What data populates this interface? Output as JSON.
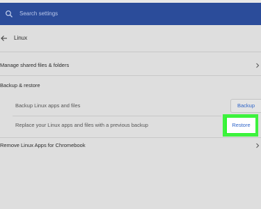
{
  "search": {
    "placeholder": "Search settings"
  },
  "page": {
    "title": "Linux"
  },
  "items": {
    "manage_shared": "Manage shared files & folders",
    "backup_restore_heading": "Backup & restore",
    "backup_description": "Backup Linux apps and files",
    "backup_button": "Backup",
    "restore_description": "Replace your Linux apps and files with a previous backup",
    "restore_button": "Restore",
    "remove_linux": "Remove Linux Apps for Chromebook"
  },
  "colors": {
    "header": "#2b4c9a",
    "background": "#dedede",
    "accent_link": "#2f64c8",
    "highlight": "#2bf52b"
  },
  "icons": {
    "search": "search-icon",
    "back": "arrow-left-icon",
    "chevron": "chevron-right-icon"
  }
}
